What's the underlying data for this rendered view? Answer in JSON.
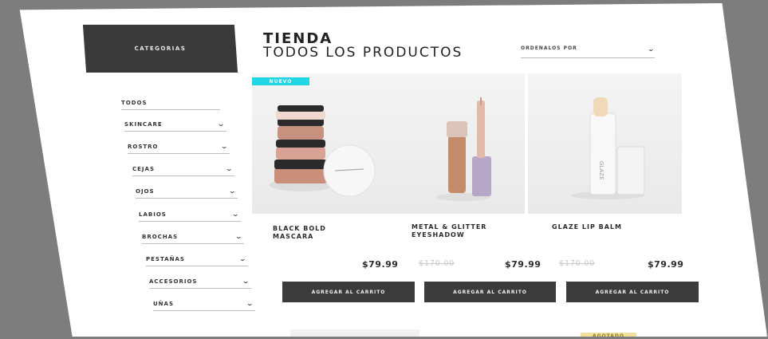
{
  "sidebar": {
    "header": "CATEGORIAS",
    "items": [
      {
        "label": "TODOS",
        "has_chevron": false
      },
      {
        "label": "SKINCARE",
        "has_chevron": true
      },
      {
        "label": "ROSTRO",
        "has_chevron": true
      },
      {
        "label": "CEJAS",
        "has_chevron": true
      },
      {
        "label": "OJOS",
        "has_chevron": true
      },
      {
        "label": "LABIOS",
        "has_chevron": true
      },
      {
        "label": "BROCHAS",
        "has_chevron": true
      },
      {
        "label": "PESTAÑAS",
        "has_chevron": true
      },
      {
        "label": "ACCESORIOS",
        "has_chevron": true
      },
      {
        "label": "UÑAS",
        "has_chevron": true
      }
    ]
  },
  "header": {
    "title": "TIENDA",
    "subtitle": "TODOS LOS PRODUCTOS",
    "sort_label": "ORDENALOS POR"
  },
  "products": [
    {
      "name": "BLACK BOLD MASCARA",
      "badge": "NUEVO",
      "tag": "",
      "price": "$79.99",
      "old_price": "",
      "button": "AGREGAR AL CARRITO"
    },
    {
      "name": "METAL & GLITTER EYESHADOW",
      "badge": "",
      "tag": "",
      "price": "$79.99",
      "old_price": "$170.00",
      "button": "AGREGAR AL CARRITO"
    },
    {
      "name": "GLAZE LIP BALM",
      "badge": "",
      "tag": "",
      "price": "$79.99",
      "old_price": "$170.00",
      "button": "AGREGAR AL CARRITO"
    }
  ],
  "bottom_row": {
    "badge": "AGOTADO"
  },
  "colors": {
    "dark": "#3a3a3a",
    "badge_new": "#1fd6e4",
    "badge_soldout": "#f3e09a",
    "backdrop": "#7d7d7d"
  }
}
